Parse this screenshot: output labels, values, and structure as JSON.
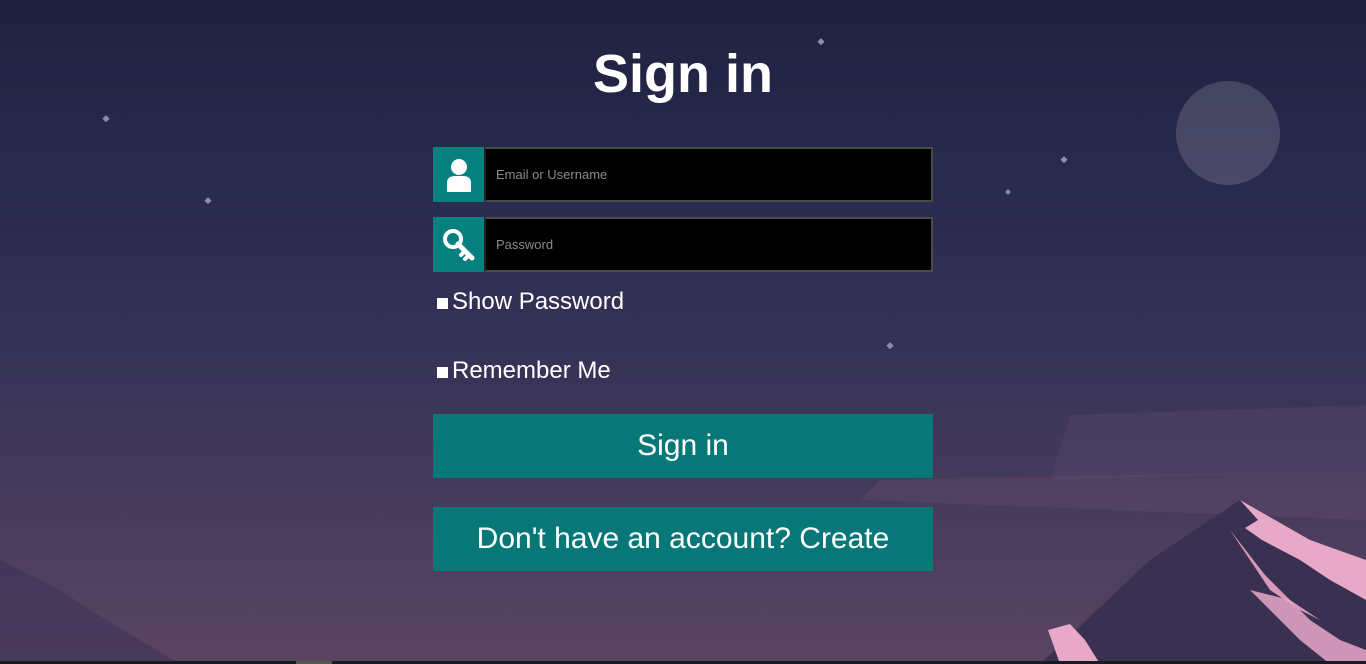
{
  "page": {
    "title": "Sign in"
  },
  "form": {
    "username_placeholder": "Email or Username",
    "password_placeholder": "Password",
    "show_password_label": "Show Password",
    "remember_me_label": "Remember Me",
    "sign_in_button": "Sign in",
    "create_account_button": "Don't have an account? Create"
  },
  "icons": {
    "username": "user-icon",
    "password": "key-icon"
  },
  "colors": {
    "accent": "#078080",
    "input_bg": "#000000",
    "text": "#ffffff",
    "moon": "#ffffff",
    "mountain_snow": "#e8a8c8"
  }
}
